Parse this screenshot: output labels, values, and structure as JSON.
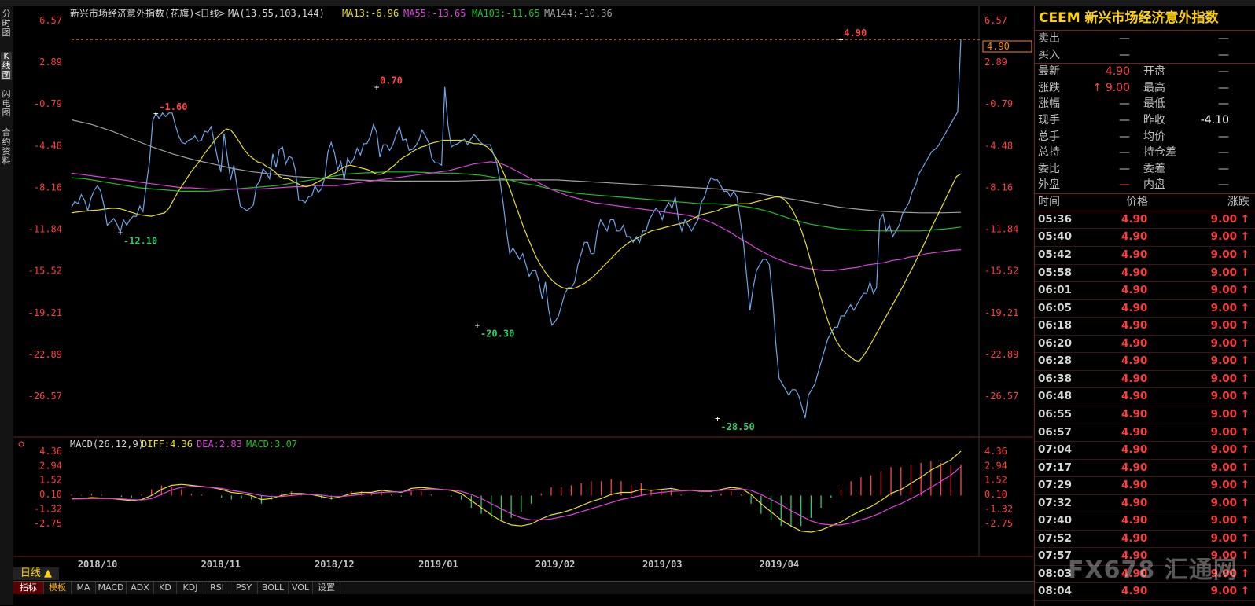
{
  "left_nav": [
    "分时图",
    "K线图",
    "闪电图",
    "合约资料"
  ],
  "main_legend": {
    "title": "新兴市场经济意外指数(花旗)<日线>",
    "ma_label": "MA(13,55,103,144)",
    "ma13": "MA13:-6.96",
    "ma55": "MA55:-13.65",
    "ma103": "MA103:-11.65",
    "ma144": "MA144:-10.36"
  },
  "macd_legend": {
    "label": "MACD(26,12,9)",
    "diff": "DIFF:4.36",
    "dea": "DEA:2.83",
    "macd": "MACD:3.07"
  },
  "price_box": "4.90",
  "day_button": "日线 ▲",
  "tabs": [
    "指标",
    "模板",
    "MA",
    "MACD",
    "ADX",
    "KD",
    "KDJ",
    "RSI",
    "PSY",
    "BOLL",
    "VOL",
    "设置"
  ],
  "chart_data": {
    "type": "line",
    "colors": {
      "close": "#6fa6e8",
      "ma13": "#e8e020",
      "ma55": "#e040e0",
      "ma103": "#20c020",
      "ma144": "#a0a0a0",
      "diff": "#e8e020",
      "dea": "#e040e0",
      "hist_up": "#ff4444",
      "hist_down": "#33cc66",
      "axis_label": "#ff3b3b"
    },
    "y_ticks": [
      "6.57",
      "2.89",
      "-0.79",
      "-4.48",
      "-8.16",
      "-11.84",
      "-15.52",
      "-19.21",
      "-22.89",
      "-26.57"
    ],
    "y_tick_values": [
      6.57,
      2.89,
      -0.79,
      -4.48,
      -8.16,
      -11.84,
      -15.52,
      -19.21,
      -22.89,
      -26.57
    ],
    "macd_ticks": [
      "4.36",
      "2.94",
      "1.52",
      "0.10",
      "-1.32",
      "-2.75"
    ],
    "macd_tick_values": [
      4.36,
      2.94,
      1.52,
      0.1,
      -1.32,
      -2.75
    ],
    "x_labels": [
      "2018/10",
      "2018/11",
      "2018/12",
      "2019/01",
      "2019/02",
      "2019/03",
      "2019/04"
    ],
    "x_label_index": [
      8,
      46,
      81,
      113,
      149,
      182,
      218
    ],
    "annotations": [
      {
        "index": 26,
        "value": -1.6,
        "text": "-1.60",
        "color": "#ff4444"
      },
      {
        "index": 15,
        "value": -12.1,
        "text": "-12.10",
        "color": "#33cc66"
      },
      {
        "index": 94,
        "value": 0.7,
        "text": "0.70",
        "color": "#ff4444"
      },
      {
        "index": 125,
        "value": -20.3,
        "text": "-20.30",
        "color": "#33cc66"
      },
      {
        "index": 199,
        "value": -28.5,
        "text": "-28.50",
        "color": "#33cc66"
      },
      {
        "index": 237,
        "value": 4.9,
        "text": "4.90",
        "color": "#ff4444"
      }
    ],
    "close": [
      -9.9,
      -9.4,
      -9.6,
      -8.8,
      -9.3,
      -10.2,
      -9.1,
      -8.4,
      -8.0,
      -8.5,
      -9.8,
      -11.5,
      -11.2,
      -10.9,
      -11.4,
      -12.1,
      -11.0,
      -11.5,
      -11.0,
      -10.7,
      -10.7,
      -9.8,
      -10.3,
      -8.0,
      -5.9,
      -2.3,
      -1.6,
      -2.1,
      -1.6,
      -1.9,
      -1.6,
      -1.6,
      -2.7,
      -3.6,
      -4.2,
      -4.3,
      -4.0,
      -3.9,
      -3.6,
      -4.1,
      -4.0,
      -3.2,
      -3.3,
      -2.8,
      -4.2,
      -5.6,
      -6.8,
      -3.4,
      -5.5,
      -7.5,
      -6.2,
      -8.1,
      -9.8,
      -10.0,
      -10.2,
      -10.0,
      -9.7,
      -8.0,
      -7.6,
      -6.5,
      -6.9,
      -7.4,
      -5.2,
      -6.4,
      -4.8,
      -4.6,
      -6.1,
      -5.4,
      -5.6,
      -6.7,
      -9.3,
      -9.3,
      -9.5,
      -9.0,
      -8.9,
      -8.0,
      -8.6,
      -8.3,
      -7.3,
      -5.0,
      -4.2,
      -5.1,
      -6.6,
      -5.9,
      -7.5,
      -5.6,
      -6.1,
      -5.6,
      -4.7,
      -5.3,
      -4.3,
      -4.3,
      -3.7,
      -2.6,
      -3.3,
      -5.5,
      -4.4,
      -4.4,
      -4.9,
      -4.4,
      -3.5,
      -2.8,
      -4.0,
      -3.9,
      -4.9,
      -4.8,
      -4.5,
      -4.0,
      -3.1,
      -3.6,
      -4.2,
      -5.6,
      -6.0,
      -6.0,
      -6.2,
      0.7,
      -2.7,
      -4.6,
      -4.4,
      -4.3,
      -4.1,
      -3.9,
      -4.4,
      -3.9,
      -3.5,
      -3.8,
      -4.2,
      -4.4,
      -4.4,
      -4.4,
      -5.2,
      -6.0,
      -7.6,
      -9.6,
      -12.0,
      -14.0,
      -13.5,
      -14.0,
      -14.5,
      -14.0,
      -15.0,
      -16.0,
      -15.5,
      -15.5,
      -16.5,
      -18.0,
      -16.5,
      -19.0,
      -20.3,
      -20.0,
      -19.5,
      -18.5,
      -17.5,
      -17.0,
      -17.0,
      -16.5,
      -15.0,
      -14.0,
      -13.0,
      -13.0,
      -14.0,
      -14.0,
      -12.0,
      -11.0,
      -11.5,
      -12.0,
      -11.0,
      -11.0,
      -12.0,
      -12.0,
      -11.5,
      -12.5,
      -12.5,
      -13.0,
      -12.5,
      -13.0,
      -12.0,
      -12.0,
      -11.0,
      -10.5,
      -10.0,
      -10.3,
      -11.0,
      -10.0,
      -9.5,
      -10.0,
      -9.0,
      -11.0,
      -12.0,
      -11.0,
      -11.5,
      -12.0,
      -11.5,
      -11.0,
      -9.5,
      -9.0,
      -8.0,
      -7.3,
      -7.5,
      -7.5,
      -8.0,
      -8.5,
      -8.5,
      -9.0,
      -8.5,
      -9.0,
      -11.0,
      -13.0,
      -16.0,
      -19.0,
      -17.0,
      -15.5,
      -15.0,
      -14.5,
      -14.5,
      -15.0,
      -18.0,
      -22.0,
      -25.0,
      -25.5,
      -26.0,
      -26.5,
      -26.0,
      -26.0,
      -26.5,
      -27.5,
      -28.5,
      -26.5,
      -26.0,
      -25.5,
      -24.5,
      -23.5,
      -22.5,
      -21.5,
      -21.0,
      -20.5,
      -20.5,
      -19.5,
      -19.5,
      -19.0,
      -18.5,
      -19.0,
      -18.5,
      -18.0,
      -17.5,
      -17.5,
      -16.5,
      -17.5,
      -17.0,
      -11.0,
      -10.5,
      -12.0,
      -11.5,
      -12.5,
      -12.0,
      -11.5,
      -10.5,
      -10.0,
      -9.5,
      -8.5,
      -8.0,
      -7.0,
      -6.5,
      -6.0,
      -5.5,
      -5.0,
      -4.8,
      -4.5,
      -4.0,
      -3.5,
      -3.0,
      -2.5,
      -2.0,
      -1.5,
      4.9
    ],
    "ma13": [
      -10.4,
      -10.35,
      -10.3,
      -10.25,
      -10.2,
      -10.18,
      -10.15,
      -10.1,
      -10.05,
      -10.0,
      -10.0,
      -10.05,
      -10.15,
      -10.3,
      -10.4,
      -10.55,
      -10.6,
      -10.65,
      -10.7,
      -10.6,
      -10.5,
      -10.4,
      -10.0,
      -9.3,
      -8.6,
      -8.0,
      -7.4,
      -6.8,
      -6.3,
      -5.8,
      -5.2,
      -4.7,
      -4.2,
      -3.7,
      -3.3,
      -3.0,
      -3.1,
      -3.6,
      -4.2,
      -4.8,
      -5.3,
      -5.6,
      -5.9,
      -6.0,
      -6.3,
      -6.5,
      -6.8,
      -7.2,
      -7.4,
      -7.4,
      -7.6,
      -7.8,
      -8.0,
      -8.1,
      -8.0,
      -7.8,
      -7.6,
      -7.4,
      -7.2,
      -7.0,
      -6.8,
      -6.5,
      -6.3,
      -6.2,
      -6.3,
      -6.4,
      -6.5,
      -6.6,
      -6.8,
      -7.0,
      -7.0,
      -6.8,
      -6.5,
      -6.2,
      -5.8,
      -5.5,
      -5.3,
      -5.0,
      -4.8,
      -4.6,
      -4.5,
      -4.3,
      -4.2,
      -4.1,
      -4.0,
      -4.0,
      -4.0,
      -4.0,
      -4.0,
      -4.1,
      -4.2,
      -4.3,
      -4.3,
      -4.4,
      -4.6,
      -5.0,
      -5.6,
      -6.3,
      -7.2,
      -8.2,
      -9.3,
      -10.4,
      -11.5,
      -12.5,
      -13.4,
      -14.3,
      -15.0,
      -15.6,
      -16.1,
      -16.5,
      -16.8,
      -17.0,
      -17.1,
      -17.1,
      -17.0,
      -16.8,
      -16.6,
      -16.3,
      -16.0,
      -15.6,
      -15.2,
      -14.8,
      -14.4,
      -14.0,
      -13.6,
      -13.3,
      -13.0,
      -12.8,
      -12.6,
      -12.4,
      -12.2,
      -12.0,
      -11.9,
      -11.8,
      -11.7,
      -11.6,
      -11.5,
      -11.4,
      -11.3,
      -11.2,
      -11.0,
      -10.8,
      -10.6,
      -10.5,
      -10.4,
      -10.3,
      -10.2,
      -10.0,
      -9.9,
      -9.8,
      -9.7,
      -9.6,
      -9.6,
      -9.6,
      -9.5,
      -9.4,
      -9.3,
      -9.2,
      -9.1,
      -9.0,
      -9.0,
      -9.2,
      -9.6,
      -10.2,
      -11.0,
      -12.0,
      -13.2,
      -14.6,
      -16.0,
      -17.4,
      -18.8,
      -20.0,
      -21.0,
      -21.8,
      -22.4,
      -22.8,
      -23.1,
      -23.4,
      -23.5,
      -23.0,
      -22.4,
      -21.7,
      -21.0,
      -20.3,
      -19.6,
      -18.9,
      -18.2,
      -17.5,
      -16.8,
      -16.0,
      -15.3,
      -14.5,
      -13.7,
      -12.9,
      -12.0,
      -11.2,
      -10.4,
      -9.6,
      -8.8,
      -8.0,
      -7.2,
      -6.96
    ],
    "ma55": [
      -6.9,
      -7.0,
      -7.1,
      -7.2,
      -7.3,
      -7.4,
      -7.5,
      -7.6,
      -7.7,
      -7.8,
      -7.9,
      -8.0,
      -8.1,
      -8.2,
      -8.2,
      -8.25,
      -8.3,
      -8.3,
      -8.3,
      -8.3,
      -8.3,
      -8.3,
      -8.3,
      -8.25,
      -8.2,
      -8.15,
      -8.1,
      -8.1,
      -8.0,
      -8.0,
      -8.0,
      -8.0,
      -7.9,
      -7.8,
      -7.7,
      -7.6,
      -7.5,
      -7.4,
      -7.3,
      -7.2,
      -7.1,
      -7.0,
      -6.9,
      -6.8,
      -6.7,
      -6.5,
      -6.3,
      -6.1,
      -6.0,
      -5.9,
      -6.0,
      -6.3,
      -6.7,
      -7.1,
      -7.5,
      -7.9,
      -8.3,
      -8.6,
      -8.9,
      -9.1,
      -9.3,
      -9.5,
      -9.6,
      -9.7,
      -9.8,
      -9.9,
      -10.0,
      -10.1,
      -10.2,
      -10.3,
      -10.4,
      -10.5,
      -10.6,
      -10.8,
      -11.0,
      -11.3,
      -11.7,
      -12.1,
      -12.6,
      -13.0,
      -13.5,
      -13.9,
      -14.3,
      -14.6,
      -14.9,
      -15.1,
      -15.3,
      -15.4,
      -15.5,
      -15.5,
      -15.4,
      -15.3,
      -15.2,
      -15.0,
      -14.9,
      -14.8,
      -14.6,
      -14.5,
      -14.3,
      -14.2,
      -14.0,
      -13.9,
      -13.8,
      -13.7,
      -13.65
    ],
    "ma103": [
      -7.3,
      -7.4,
      -7.6,
      -7.8,
      -8.0,
      -8.2,
      -8.3,
      -8.4,
      -8.5,
      -8.5,
      -8.5,
      -8.4,
      -8.3,
      -8.2,
      -8.1,
      -8.0,
      -7.8,
      -7.6,
      -7.4,
      -7.2,
      -7.0,
      -6.9,
      -6.85,
      -6.8,
      -6.8,
      -6.8,
      -6.85,
      -6.9,
      -6.9,
      -7.0,
      -7.1,
      -7.3,
      -7.5,
      -7.8,
      -8.0,
      -8.3,
      -8.5,
      -8.7,
      -8.8,
      -8.9,
      -9.0,
      -9.1,
      -9.2,
      -9.3,
      -9.4,
      -9.5,
      -9.6,
      -9.6,
      -9.7,
      -9.8,
      -10.0,
      -10.3,
      -10.7,
      -11.1,
      -11.4,
      -11.6,
      -11.8,
      -11.9,
      -11.95,
      -12.0,
      -12.0,
      -12.0,
      -12.0,
      -11.9,
      -11.8,
      -11.65
    ],
    "ma144": [
      -2.2,
      -2.6,
      -3.2,
      -3.9,
      -4.6,
      -5.2,
      -5.7,
      -6.1,
      -6.5,
      -6.8,
      -7.0,
      -7.2,
      -7.3,
      -7.4,
      -7.5,
      -7.55,
      -7.6,
      -7.6,
      -7.6,
      -7.6,
      -7.55,
      -7.5,
      -7.5,
      -7.5,
      -7.5,
      -7.6,
      -7.7,
      -7.8,
      -7.9,
      -8.0,
      -8.1,
      -8.2,
      -8.3,
      -8.5,
      -8.7,
      -9.0,
      -9.3,
      -9.6,
      -9.9,
      -10.1,
      -10.25,
      -10.35,
      -10.4,
      -10.4,
      -10.36
    ],
    "diff": [
      -0.3,
      -0.3,
      -0.2,
      -0.25,
      -0.3,
      -0.4,
      -0.5,
      -0.4,
      0.0,
      0.6,
      1.0,
      1.1,
      1.0,
      0.9,
      0.8,
      0.6,
      0.3,
      0.2,
      0.0,
      -0.4,
      -0.3,
      0.0,
      0.2,
      0.2,
      0.1,
      -0.1,
      -0.3,
      -0.1,
      0.2,
      0.3,
      0.3,
      0.5,
      0.4,
      0.3,
      0.7,
      0.8,
      0.7,
      0.6,
      0.5,
      0.2,
      -0.5,
      -1.2,
      -1.9,
      -2.5,
      -2.9,
      -3.0,
      -2.8,
      -2.3,
      -1.9,
      -1.7,
      -1.4,
      -1.0,
      -0.6,
      -0.3,
      0.1,
      0.3,
      0.3,
      0.6,
      0.5,
      0.6,
      0.7,
      0.5,
      0.5,
      0.4,
      0.4,
      0.6,
      0.8,
      0.7,
      0.1,
      -0.8,
      -1.6,
      -2.4,
      -3.0,
      -3.5,
      -3.6,
      -3.4,
      -3.0,
      -2.6,
      -2.0,
      -1.5,
      -1.1,
      -0.5,
      0.2,
      0.6,
      1.2,
      1.8,
      2.5,
      3.0,
      3.5,
      4.36
    ],
    "dea": [
      -0.35,
      -0.33,
      -0.3,
      -0.3,
      -0.3,
      -0.33,
      -0.4,
      -0.45,
      -0.3,
      0.1,
      0.55,
      0.8,
      0.9,
      0.85,
      0.8,
      0.7,
      0.5,
      0.35,
      0.2,
      0.0,
      -0.1,
      -0.1,
      0.0,
      0.1,
      0.1,
      0.05,
      -0.1,
      -0.1,
      0.0,
      0.1,
      0.2,
      0.3,
      0.35,
      0.35,
      0.5,
      0.6,
      0.65,
      0.6,
      0.55,
      0.4,
      0.1,
      -0.3,
      -0.8,
      -1.3,
      -1.8,
      -2.2,
      -2.4,
      -2.4,
      -2.3,
      -2.1,
      -1.9,
      -1.6,
      -1.3,
      -1.0,
      -0.7,
      -0.4,
      -0.2,
      0.0,
      0.2,
      0.3,
      0.4,
      0.45,
      0.5,
      0.45,
      0.45,
      0.5,
      0.6,
      0.65,
      0.5,
      0.1,
      -0.4,
      -0.9,
      -1.5,
      -2.0,
      -2.5,
      -2.8,
      -2.9,
      -2.9,
      -2.7,
      -2.4,
      -2.1,
      -1.7,
      -1.2,
      -0.8,
      -0.3,
      0.2,
      0.8,
      1.4,
      2.0,
      2.83
    ]
  }
}
